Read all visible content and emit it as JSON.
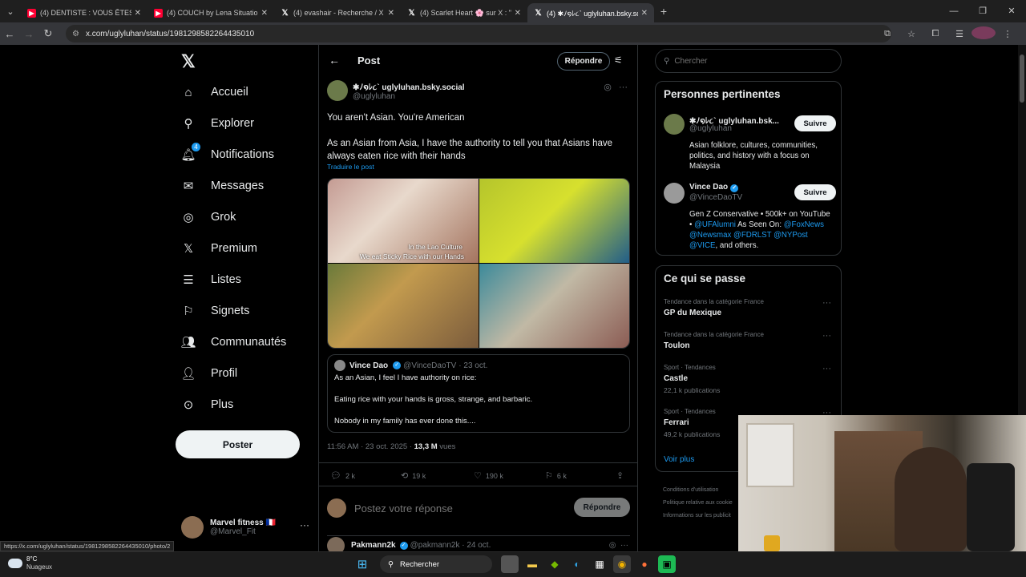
{
  "browser": {
    "tabs": [
      {
        "label": "(4) DENTISTE : VOUS ÊTES SALE",
        "icon": "youtube-icon"
      },
      {
        "label": "(4) COUCH by Lena Situations",
        "icon": "youtube-icon"
      },
      {
        "label": "(4) evashair - Recherche / X",
        "icon": "x-icon"
      },
      {
        "label": "(4) Scarlet Heart 🌸 sur X : \"No",
        "icon": "x-icon"
      },
      {
        "label": "(4) ✱ﾉ໑ﾚ૮` uglyluhan.bsky.soc",
        "icon": "x-icon"
      }
    ],
    "url": "x.com/uglyluhan/status/1981298582264435010",
    "status_url": "https://x.com/uglyluhan/status/1981298582264435010/photo/2"
  },
  "nav": {
    "items": [
      {
        "label": "Accueil",
        "icon": "home-icon"
      },
      {
        "label": "Explorer",
        "icon": "search-icon"
      },
      {
        "label": "Notifications",
        "icon": "bell-icon",
        "badge": "4"
      },
      {
        "label": "Messages",
        "icon": "envelope-icon"
      },
      {
        "label": "Grok",
        "icon": "grok-icon"
      },
      {
        "label": "Premium",
        "icon": "x-icon"
      },
      {
        "label": "Listes",
        "icon": "list-icon"
      },
      {
        "label": "Signets",
        "icon": "bookmark-icon"
      },
      {
        "label": "Communautés",
        "icon": "people-icon"
      },
      {
        "label": "Profil",
        "icon": "person-icon"
      },
      {
        "label": "Plus",
        "icon": "more-circle-icon"
      }
    ],
    "post_button": "Poster",
    "account": {
      "name": "Marvel fitness 🇫🇷",
      "handle": "@Marvel_Fit"
    }
  },
  "post": {
    "header_title": "Post",
    "reply_button": "Répondre",
    "author_name": "✱ﾉ໑ﾚ૮` uglyluhan.bsky.social",
    "author_handle": "@uglyluhan",
    "text_line1": "You aren't Asian. You're American",
    "text_line2": "As an Asian from Asia, I have the authority to tell you that Asians have always eaten rice with their hands",
    "translate": "Traduire le post",
    "image_caption_1": "In the Lao Culture",
    "image_caption_2": "We eat Sticky Rice with our Hands",
    "quote": {
      "name": "Vince Dao",
      "handle": "@VinceDaoTV",
      "date": "· 23 oct.",
      "line1": "As an Asian, I feel I have authority on rice:",
      "line2": "Eating rice with your hands is gross, strange, and barbaric.",
      "line3": "Nobody in my family has ever done this...."
    },
    "timestamp": "11:56 AM · 23 oct. 2025 · ",
    "views_count": "13,3 M",
    "views_label": " vues",
    "replies": "2 k",
    "reposts": "19 k",
    "likes": "190 k",
    "bookmarks": "6 k",
    "reply_placeholder": "Postez votre réponse",
    "reply_submit": "Répondre",
    "next_post": {
      "name": "Pakmann2k",
      "handle": "@pakmann2k · 24 oct."
    }
  },
  "right": {
    "search_placeholder": "Chercher",
    "people_title": "Personnes pertinentes",
    "people": [
      {
        "name": "✱ﾉ໑ﾚ૮` uglyluhan.bsk...",
        "handle": "@uglyluhan",
        "follow": "Suivre",
        "bio": "Asian folklore, cultures, communities, politics, and history with a focus on Malaysia"
      },
      {
        "name": "Vince Dao",
        "handle": "@VinceDaoTV",
        "follow": "Suivre",
        "bio_plain1": "Gen Z Conservative • 500k+ on YouTube • ",
        "bio_link1": "@UFAlumni",
        "bio_plain2": " As Seen On: ",
        "bio_link2": "@FoxNews @Newsmax @FDRLST @NYPost @VICE",
        "bio_plain3": ", and others."
      }
    ],
    "trends_title": "Ce qui se passe",
    "trends": [
      {
        "category": "Tendance dans la catégorie France",
        "name": "GP du Mexique",
        "count": ""
      },
      {
        "category": "Tendance dans la catégorie France",
        "name": "Toulon",
        "count": ""
      },
      {
        "category": "Sport · Tendances",
        "name": "Castle",
        "count": "22,1 k publications"
      },
      {
        "category": "Sport · Tendances",
        "name": "Ferrari",
        "count": "49,2 k publications"
      }
    ],
    "see_more": "Voir plus",
    "footer": [
      "Conditions d'utilisation",
      "Politique relative aux cookie",
      "Informations sur les publicit"
    ]
  },
  "taskbar": {
    "temp": "8°C",
    "condition": "Nuageux",
    "search": "Rechercher"
  }
}
